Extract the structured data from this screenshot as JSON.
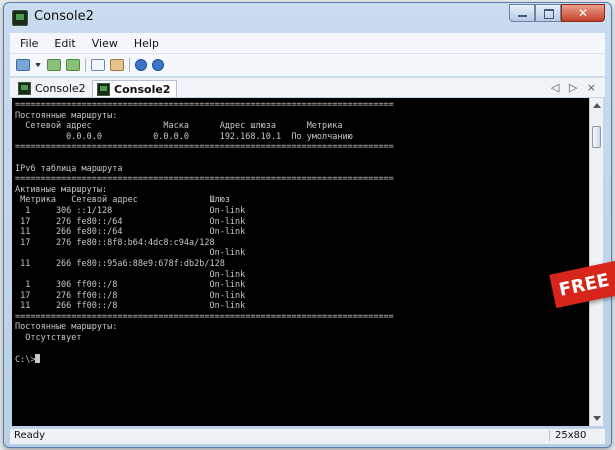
{
  "window": {
    "title": "Console2"
  },
  "menu": [
    "File",
    "Edit",
    "View",
    "Help"
  ],
  "toolbar": {
    "icons": [
      "new-tab-icon",
      "dropdown-caret-icon",
      "previous-tab-icon",
      "next-tab-icon",
      "copy-icon",
      "paste-icon",
      "info-icon",
      "help-icon"
    ]
  },
  "tabs": [
    {
      "label": "Console2",
      "active": false
    },
    {
      "label": "Console2",
      "active": true
    }
  ],
  "tab_nav": "◁ ▷ ×",
  "console": {
    "lines": [
      "==========================================================================",
      "Постоянные маршруты:",
      "  Сетевой адрес              Маска      Адрес шлюза      Метрика",
      "          0.0.0.0          0.0.0.0      192.168.10.1  По умолчанию",
      "==========================================================================",
      "",
      "IPv6 таблица маршрута",
      "==========================================================================",
      "Активные маршруты:",
      " Метрика   Сетевой адрес              Шлюз",
      "  1     306 ::1/128                   On-link",
      " 17     276 fe80::/64                 On-link",
      " 11     266 fe80::/64                 On-link",
      " 17     276 fe80::8f8:b64:4dc8:c94a/128",
      "                                      On-link",
      " 11     266 fe80::95a6:88e9:678f:db2b/128",
      "                                      On-link",
      "  1     306 ff00::/8                  On-link",
      " 17     276 ff00::/8                  On-link",
      " 11     266 ff00::/8                  On-link",
      "==========================================================================",
      "Постоянные маршруты:",
      "  Отсутствует",
      "",
      "C:\\>"
    ]
  },
  "status": {
    "text": "Ready",
    "size": "25x80"
  },
  "badge": {
    "text": "FREE",
    "color": "#d7251c"
  }
}
